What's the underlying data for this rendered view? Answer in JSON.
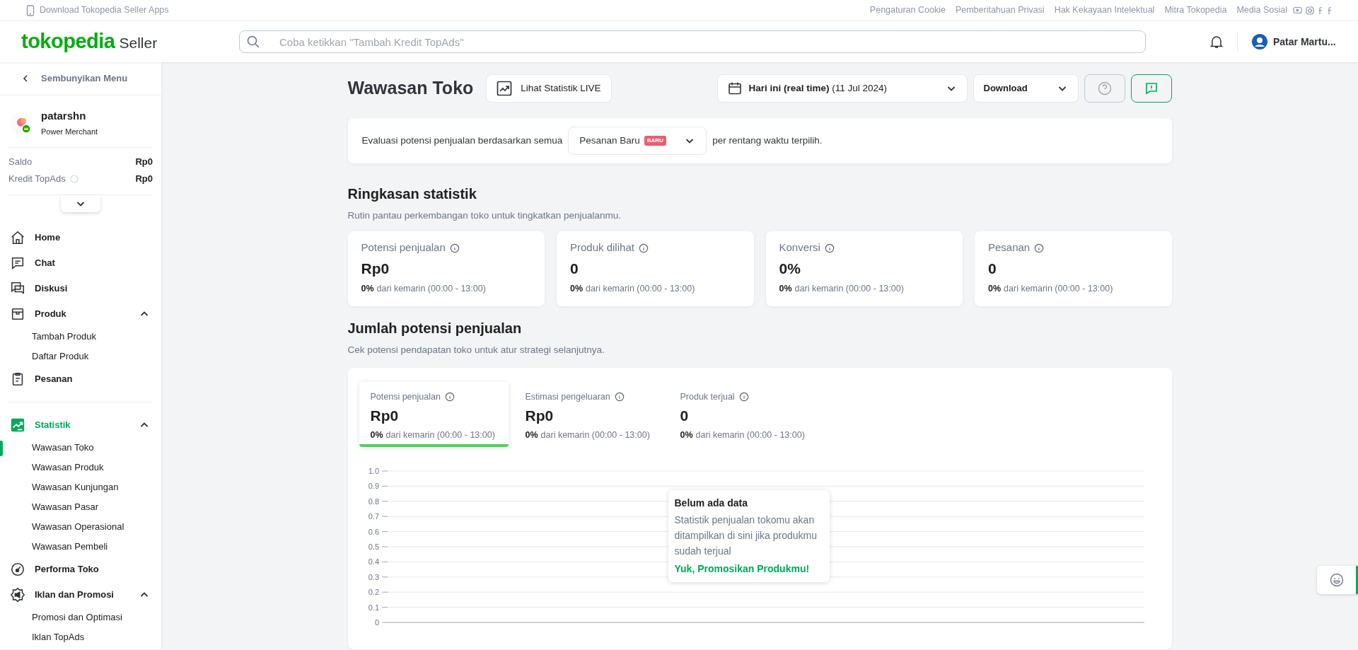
{
  "top_strip": {
    "download_link": "Download Tokopedia Seller Apps",
    "links": [
      "Pengaturan Cookie",
      "Pemberitahuan Privasi",
      "Hak Kekayaan Intelektual",
      "Mitra Tokopedia",
      "Media Sosial"
    ]
  },
  "header": {
    "logo": "tokopedia",
    "logo_suffix": "Seller",
    "search": {
      "placeholder": "Coba ketikkan \"Tambah Kredit TopAds\""
    },
    "user_name": "Patar Martu..."
  },
  "sidebar": {
    "hide_menu": "Sembunyikan Menu",
    "shop": {
      "name": "patarshn",
      "tier": "Power Merchant"
    },
    "balances": [
      {
        "label": "Saldo",
        "value": "Rp0"
      },
      {
        "label": "Kredit TopAds",
        "value": "Rp0"
      }
    ],
    "items": [
      {
        "label": "Home",
        "selected": false
      },
      {
        "label": "Chat",
        "selected": false
      },
      {
        "label": "Diskusi",
        "selected": false
      },
      {
        "label": "Produk",
        "selected": false,
        "expanded": true,
        "children": [
          {
            "label": "Tambah Produk",
            "selected": false
          },
          {
            "label": "Daftar Produk",
            "selected": false
          }
        ]
      },
      {
        "label": "Pesanan",
        "selected": false
      },
      {
        "label": "Statistik",
        "selected": true,
        "expanded": true,
        "children": [
          {
            "label": "Wawasan Toko",
            "selected": true
          },
          {
            "label": "Wawasan Produk",
            "selected": false
          },
          {
            "label": "Wawasan Kunjungan",
            "selected": false
          },
          {
            "label": "Wawasan Pasar",
            "selected": false
          },
          {
            "label": "Wawasan Operasional",
            "selected": false
          },
          {
            "label": "Wawasan Pembeli",
            "selected": false
          }
        ]
      },
      {
        "label": "Performa Toko",
        "selected": false
      },
      {
        "label": "Iklan dan Promosi",
        "selected": false,
        "expanded": true,
        "children": [
          {
            "label": "Promosi dan Optimasi",
            "selected": false
          },
          {
            "label": "Iklan TopAds",
            "selected": false
          }
        ]
      }
    ]
  },
  "page": {
    "title": "Wawasan Toko",
    "live_button": "Lihat Statistik LIVE",
    "date_range": {
      "bold": "Hari ini (real time)",
      "date": "(11 Jul 2024)"
    },
    "download": "Download",
    "evaluation": {
      "prefix": "Evaluasi potensi penjualan berdasarkan semua",
      "dropdown": "Pesanan Baru",
      "badge": "BARU",
      "suffix": "per rentang waktu terpilih."
    },
    "summary": {
      "title": "Ringkasan statistik",
      "subtitle": "Rutin pantau perkembangan toko untuk tingkatkan penjualanmu.",
      "cards": [
        {
          "label": "Potensi penjualan",
          "value": "Rp0",
          "change": "0%",
          "note": "dari kemarin (00:00 - 13:00)"
        },
        {
          "label": "Produk dilihat",
          "value": "0",
          "change": "0%",
          "note": "dari kemarin (00:00 - 13:00)"
        },
        {
          "label": "Konversi",
          "value": "0%",
          "change": "0%",
          "note": "dari kemarin (00:00 - 13:00)"
        },
        {
          "label": "Pesanan",
          "value": "0",
          "change": "0%",
          "note": "dari kemarin (00:00 - 13:00)"
        }
      ]
    },
    "potential": {
      "title": "Jumlah potensi penjualan",
      "subtitle": "Cek potensi pendapatan toko untuk atur strategi selanjutnya.",
      "tabs": [
        {
          "label": "Potensi penjualan",
          "value": "Rp0",
          "change": "0%",
          "note": "dari kemarin (00:00 - 13:00)",
          "selected": true
        },
        {
          "label": "Estimasi pengeluaran",
          "value": "Rp0",
          "change": "0%",
          "note": "dari kemarin (00:00 - 13:00)",
          "selected": false
        },
        {
          "label": "Produk terjual",
          "value": "0",
          "change": "0%",
          "note": "dari kemarin (00:00 - 13:00)",
          "selected": false
        }
      ],
      "y_axis_labels": [
        "1.0",
        "0.9",
        "0.8",
        "0.7",
        "0.6",
        "0.5",
        "0.4",
        "0.3",
        "0.2",
        "0.1",
        "0"
      ],
      "empty_state": {
        "title": "Belum ada data",
        "text": "Statistik penjualan tokomu akan ditampilkan di sini jika produkmu sudah terjual",
        "link": "Yuk, Promosikan Produkmu!"
      }
    }
  }
}
